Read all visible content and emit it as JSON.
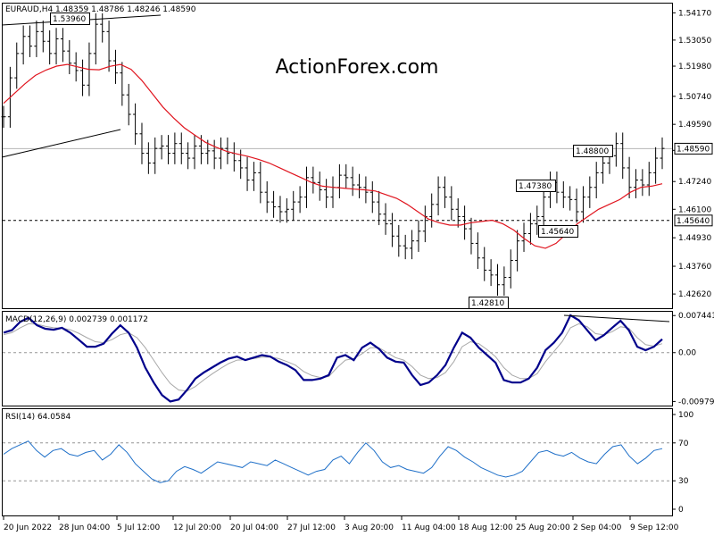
{
  "chart_data": [
    {
      "type": "line",
      "title": "EURAUD,H4  1.48359 1.48786 1.48246 1.48590",
      "watermark": "ActionForex.com",
      "ylim": [
        1.42,
        1.5455
      ],
      "y_ticks": [
        "1.54170",
        "1.53050",
        "1.51980",
        "1.50740",
        "1.49590",
        "1.48520",
        "1.47240",
        "1.46100",
        "1.44930",
        "1.43760",
        "1.42620"
      ],
      "current_price_label": "1.48590",
      "support_label": "1.45640",
      "annotations": [
        "1.53960",
        "1.48800",
        "1.47380",
        "1.45640",
        "1.42810"
      ],
      "x_tick_labels": [
        "20 Jun 2022",
        "28 Jun 04:00",
        "5 Jul 12:00",
        "12 Jul 20:00",
        "20 Jul 04:00",
        "27 Jul 12:00",
        "3 Aug 20:00",
        "11 Aug 04:00",
        "18 Aug 12:00",
        "25 Aug 20:00",
        "2 Sep 04:00",
        "9 Sep 12:00"
      ],
      "series": [
        {
          "role": "price",
          "color": "#000000",
          "values": [
            1.499,
            1.515,
            1.525,
            1.532,
            1.528,
            1.534,
            1.53,
            1.525,
            1.531,
            1.526,
            1.521,
            1.518,
            1.512,
            1.525,
            1.537,
            1.534,
            1.522,
            1.517,
            1.508,
            1.5,
            1.492,
            1.484,
            1.48,
            1.486,
            1.487,
            1.484,
            1.488,
            1.484,
            1.482,
            1.487,
            1.484,
            1.485,
            1.482,
            1.486,
            1.484,
            1.481,
            1.478,
            1.473,
            1.476,
            1.468,
            1.464,
            1.462,
            1.46,
            1.461,
            1.464,
            1.466,
            1.474,
            1.472,
            1.469,
            1.466,
            1.47,
            1.475,
            1.474,
            1.471,
            1.47,
            1.468,
            1.464,
            1.459,
            1.455,
            1.45,
            1.446,
            1.445,
            1.448,
            1.452,
            1.458,
            1.463,
            1.47,
            1.466,
            1.461,
            1.458,
            1.453,
            1.447,
            1.441,
            1.436,
            1.434,
            1.43,
            1.433,
            1.44,
            1.448,
            1.451,
            1.455,
            1.458,
            1.466,
            1.472,
            1.468,
            1.466,
            1.465,
            1.46,
            1.466,
            1.47,
            1.476,
            1.48,
            1.483,
            1.488,
            1.478,
            1.47,
            1.473,
            1.471,
            1.476,
            1.482,
            1.486
          ]
        },
        {
          "role": "moving-average",
          "color": "#e0141e",
          "values": [
            1.5045,
            1.5085,
            1.5125,
            1.516,
            1.5182,
            1.5198,
            1.5205,
            1.5195,
            1.5185,
            1.5183,
            1.5197,
            1.5205,
            1.5185,
            1.514,
            1.5085,
            1.503,
            1.4985,
            1.4945,
            1.4915,
            1.4885,
            1.4865,
            1.4848,
            1.4837,
            1.4827,
            1.4815,
            1.48,
            1.478,
            1.476,
            1.474,
            1.472,
            1.4705,
            1.47,
            1.4697,
            1.4693,
            1.469,
            1.4685,
            1.467,
            1.4655,
            1.463,
            1.46,
            1.457,
            1.4555,
            1.4545,
            1.4545,
            1.4555,
            1.456,
            1.4565,
            1.455,
            1.4525,
            1.449,
            1.446,
            1.445,
            1.447,
            1.451,
            1.455,
            1.458,
            1.461,
            1.463,
            1.465,
            1.468,
            1.47,
            1.4705,
            1.4715
          ]
        }
      ]
    },
    {
      "type": "line",
      "title": "MACD(12,26,9)  0.002739 0.001172",
      "ylim": [
        -0.0108,
        0.0082
      ],
      "y_ticks": [
        "0.007441",
        "0.00",
        "-0.009794"
      ],
      "series": [
        {
          "role": "macd",
          "color": "#00008b",
          "values": [
            0.004,
            0.0045,
            0.0062,
            0.007,
            0.0055,
            0.0048,
            0.0046,
            0.005,
            0.004,
            0.0026,
            0.0012,
            0.0012,
            0.0018,
            0.0038,
            0.0055,
            0.004,
            0.001,
            -0.003,
            -0.006,
            -0.0085,
            -0.0098,
            -0.0094,
            -0.0075,
            -0.0052,
            -0.004,
            -0.003,
            -0.002,
            -0.0012,
            -0.0008,
            -0.0015,
            -0.001,
            -0.0005,
            -0.0008,
            -0.0018,
            -0.0025,
            -0.0035,
            -0.0055,
            -0.0055,
            -0.0052,
            -0.0045,
            -0.001,
            -0.0005,
            -0.0015,
            0.001,
            0.002,
            0.0008,
            -0.001,
            -0.0018,
            -0.002,
            -0.0045,
            -0.0065,
            -0.006,
            -0.0045,
            -0.0025,
            0.001,
            0.004,
            0.003,
            0.001,
            -0.0005,
            -0.002,
            -0.0055,
            -0.006,
            -0.006,
            -0.0052,
            -0.003,
            0.0005,
            0.002,
            0.004,
            0.0075,
            0.0065,
            0.0045,
            0.0025,
            0.0035,
            0.005,
            0.0064,
            0.0045,
            0.0012,
            0.0005,
            0.0012,
            0.0027
          ]
        },
        {
          "role": "signal",
          "color": "#a8a8a8",
          "values": [
            0.0036,
            0.004,
            0.005,
            0.0058,
            0.0057,
            0.0053,
            0.005,
            0.0049,
            0.0046,
            0.0039,
            0.003,
            0.0022,
            0.002,
            0.0026,
            0.0036,
            0.004,
            0.003,
            0.001,
            -0.0015,
            -0.004,
            -0.0062,
            -0.0075,
            -0.0077,
            -0.0068,
            -0.0055,
            -0.0043,
            -0.0032,
            -0.0022,
            -0.0015,
            -0.0014,
            -0.0012,
            -0.0009,
            -0.0009,
            -0.0012,
            -0.0018,
            -0.0025,
            -0.0038,
            -0.0046,
            -0.005,
            -0.0048,
            -0.003,
            -0.0015,
            -0.0012,
            -0.0002,
            0.001,
            0.001,
            0.0,
            -0.001,
            -0.0015,
            -0.0028,
            -0.0045,
            -0.0052,
            -0.005,
            -0.004,
            -0.0018,
            0.0012,
            0.0022,
            0.0018,
            0.0006,
            -0.0008,
            -0.003,
            -0.0045,
            -0.0052,
            -0.0052,
            -0.0042,
            -0.0018,
            0.0002,
            0.0022,
            0.005,
            0.0058,
            0.0052,
            0.0038,
            0.0036,
            0.0042,
            0.0052,
            0.0049,
            0.003,
            0.0016,
            0.0013,
            0.0018
          ]
        }
      ]
    },
    {
      "type": "line",
      "title": "RSI(14) 64.0584",
      "ylim": [
        0,
        100
      ],
      "y_ticks": [
        "100",
        "70",
        "30",
        "0"
      ],
      "levels": [
        70,
        30
      ],
      "series": [
        {
          "role": "rsi",
          "color": "#1e6fc8",
          "values": [
            58,
            64,
            68,
            72,
            62,
            55,
            62,
            64,
            58,
            56,
            60,
            62,
            52,
            58,
            68,
            60,
            48,
            40,
            32,
            28,
            30,
            40,
            45,
            42,
            38,
            44,
            50,
            48,
            46,
            44,
            50,
            48,
            46,
            52,
            48,
            44,
            40,
            36,
            40,
            42,
            52,
            56,
            48,
            60,
            70,
            62,
            50,
            44,
            46,
            42,
            40,
            38,
            44,
            56,
            66,
            62,
            55,
            50,
            44,
            40,
            36,
            34,
            36,
            40,
            50,
            60,
            62,
            58,
            56,
            60,
            54,
            50,
            48,
            58,
            66,
            68,
            56,
            48,
            54,
            62,
            64
          ]
        }
      ]
    }
  ]
}
